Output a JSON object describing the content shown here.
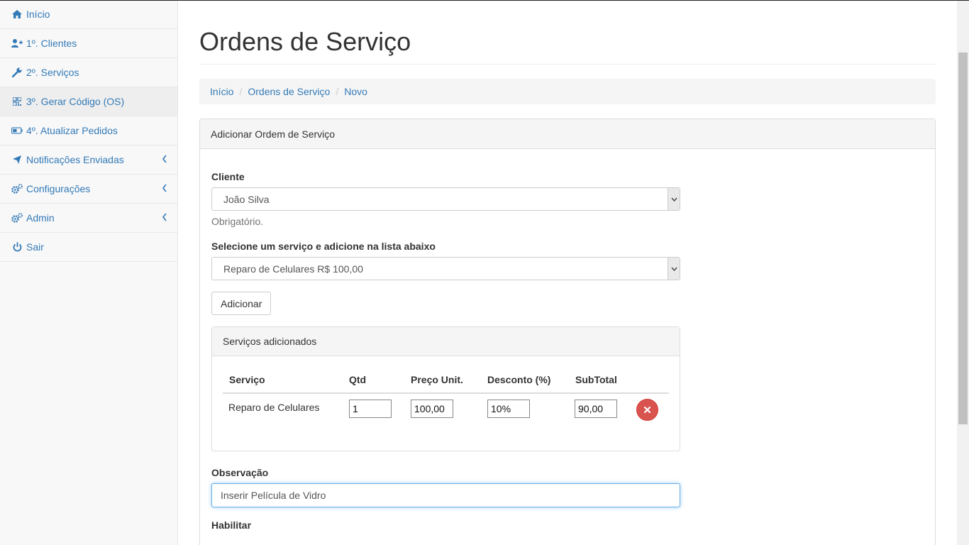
{
  "sidebar": {
    "items": [
      {
        "label": "Início",
        "icon": "home-icon"
      },
      {
        "label": "1º. Clientes",
        "icon": "user-plus-icon"
      },
      {
        "label": "2º. Serviços",
        "icon": "wrench-icon"
      },
      {
        "label": "3º. Gerar Código (OS)",
        "icon": "qrcode-icon"
      },
      {
        "label": "4º. Atualizar Pedidos",
        "icon": "battery-icon"
      },
      {
        "label": "Notificações Enviadas",
        "icon": "plane-icon"
      },
      {
        "label": "Configurações",
        "icon": "cogs-icon"
      },
      {
        "label": "Admin",
        "icon": "cogs-icon"
      },
      {
        "label": "Sair",
        "icon": "power-icon"
      }
    ]
  },
  "page": {
    "title": "Ordens de Serviço"
  },
  "breadcrumb": [
    "Início",
    "Ordens de Serviço",
    "Novo"
  ],
  "form": {
    "panel_title": "Adicionar Ordem de Serviço",
    "cliente_label": "Cliente",
    "cliente_value": "João Silva",
    "cliente_help": "Obrigatório.",
    "servico_label": "Selecione um serviço e adicione na lista abaixo",
    "servico_value": "Reparo de Celulares R$ 100,00",
    "add_button": "Adicionar",
    "servicos_panel_title": "Serviços adicionados",
    "table": {
      "headers": [
        "Serviço",
        "Qtd",
        "Preço Unit.",
        "Desconto (%)",
        "SubTotal"
      ],
      "rows": [
        {
          "servico": "Reparo de Celulares",
          "qtd": "1",
          "preco": "100,00",
          "desconto": "10%",
          "subtotal": "90,00"
        }
      ]
    },
    "observacao_label": "Observação",
    "observacao_value": "Inserir Película de Vidro",
    "habilitar_label": "Habilitar"
  },
  "colors": {
    "link": "#337ab7",
    "danger": "#d9534f",
    "focus": "#66afe9"
  }
}
